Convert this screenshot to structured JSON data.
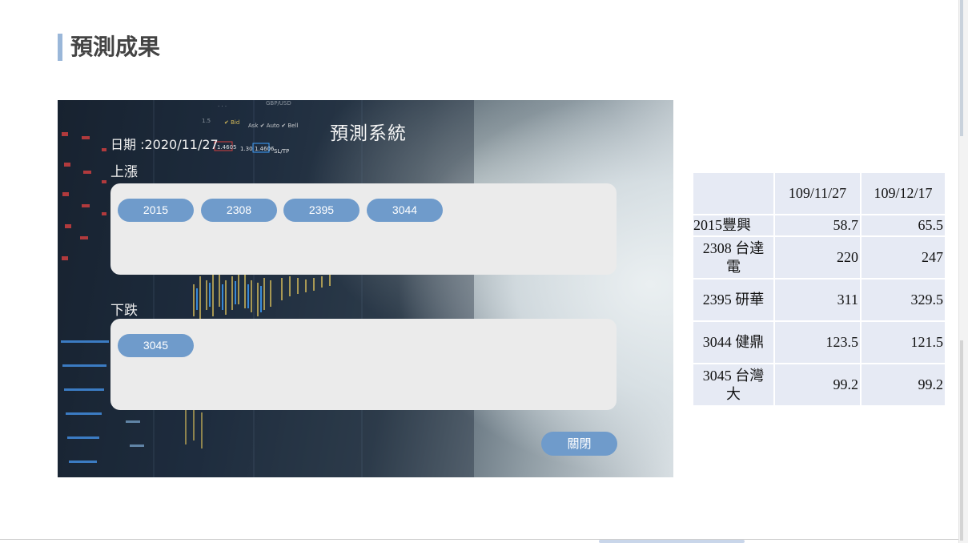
{
  "page": {
    "title": "預測成果"
  },
  "panel": {
    "title": "預測系統",
    "date_label": "日期 :2020/11/27",
    "up_label": "上漲",
    "down_label": "下跌",
    "up_stocks": [
      "2015",
      "2308",
      "2395",
      "3044"
    ],
    "down_stocks": [
      "3045"
    ],
    "close_label": "關閉"
  },
  "table": {
    "headers": [
      "",
      "109/11/27",
      "109/12/17"
    ],
    "rows": [
      {
        "name": "2015豐興",
        "v1": "58.7",
        "v2": "65.5"
      },
      {
        "name": "2308 台達電",
        "v1": "220",
        "v2": "247"
      },
      {
        "name": "2395 研華",
        "v1": "311",
        "v2": "329.5"
      },
      {
        "name": "3044 健鼎",
        "v1": "123.5",
        "v2": "121.5"
      },
      {
        "name": "3045 台灣大",
        "v1": "99.2",
        "v2": "99.2"
      }
    ]
  },
  "colors": {
    "accent": "#6f9bcb",
    "title_bar": "#9ab7d9",
    "table_cell": "#e6eaf4",
    "chip_box": "#ebebeb"
  }
}
